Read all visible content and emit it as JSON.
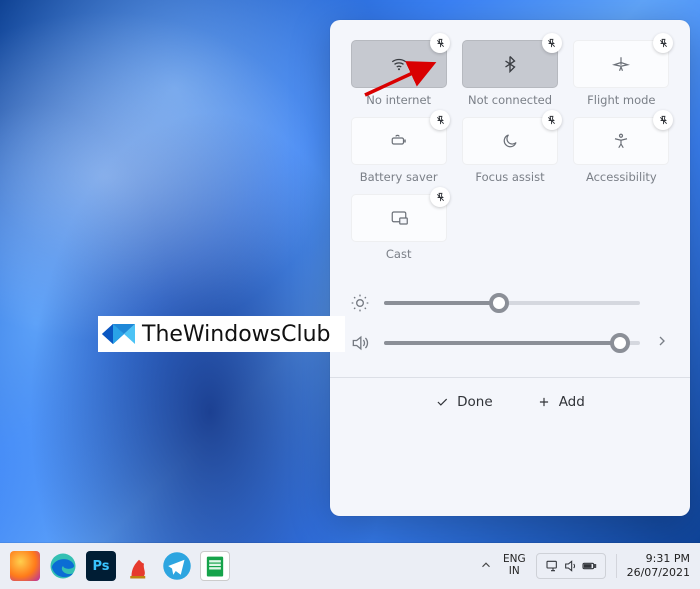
{
  "panel": {
    "tiles": [
      {
        "name": "wifi-tile",
        "icon": "wifi-icon",
        "label": "No internet",
        "active": true
      },
      {
        "name": "bluetooth-tile",
        "icon": "bluetooth-icon",
        "label": "Not connected",
        "active": true
      },
      {
        "name": "flight-mode-tile",
        "icon": "airplane-icon",
        "label": "Flight mode",
        "active": false
      },
      {
        "name": "battery-saver-tile",
        "icon": "battery-saver-icon",
        "label": "Battery saver",
        "active": false
      },
      {
        "name": "focus-assist-tile",
        "icon": "moon-icon",
        "label": "Focus assist",
        "active": false
      },
      {
        "name": "accessibility-tile",
        "icon": "accessibility-icon",
        "label": "Accessibility",
        "active": false
      },
      {
        "name": "cast-tile",
        "icon": "cast-icon",
        "label": "Cast",
        "active": false
      }
    ],
    "brightness": {
      "value": 45
    },
    "volume": {
      "value": 92
    },
    "footer": {
      "done_label": "Done",
      "add_label": "Add"
    }
  },
  "watermark": {
    "text": "TheWindowsClub"
  },
  "taskbar": {
    "tray_icon": "chevron-up-icon",
    "lang": {
      "line1": "ENG",
      "line2": "IN"
    },
    "clock": {
      "time": "9:31 PM",
      "date": "26/07/2021"
    }
  }
}
